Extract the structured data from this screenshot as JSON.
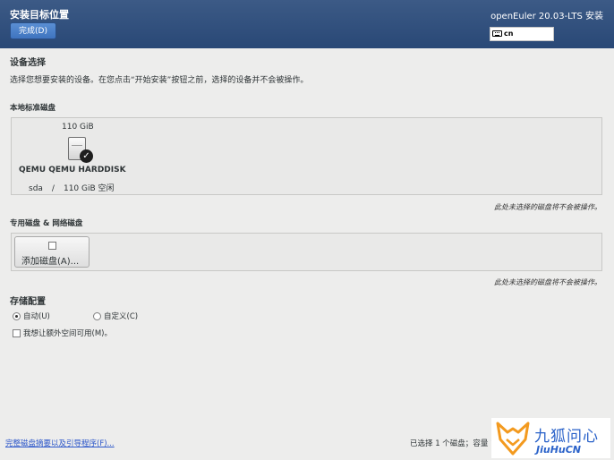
{
  "header": {
    "title": "安装目标位置",
    "done_button": "完成(D)",
    "product": "openEuler 20.03-LTS 安装",
    "keyboard_layout": "cn"
  },
  "device_selection": {
    "title": "设备选择",
    "description": "选择您想要安装的设备。在您点击“开始安装”按钮之前，选择的设备并不会被操作。"
  },
  "local_disks": {
    "title": "本地标准磁盘",
    "disk": {
      "size": "110 GiB",
      "name": "QEMU QEMU HARDDISK",
      "device": "sda",
      "separator": "/",
      "free": "110 GiB 空闲"
    },
    "note": "此处未选择的磁盘将不会被操作。"
  },
  "special_disks": {
    "title": "专用磁盘 & 网络磁盘",
    "add_button": "添加磁盘(A)...",
    "note": "此处未选择的磁盘将不会被操作。"
  },
  "storage_config": {
    "title": "存储配置",
    "options": [
      {
        "label": "自动(U)",
        "selected": true
      },
      {
        "label": "自定义(C)",
        "selected": false
      }
    ],
    "extra_space_label": "我想让额外空间可用(M)。",
    "extra_space_checked": false
  },
  "footer": {
    "summary_link": "完整磁盘摘要以及引导程序(F)...",
    "status": "已选择 1 个磁盘；容量 1"
  },
  "watermark": {
    "cn": "九狐问心",
    "en": "JiuHuCN"
  },
  "colors": {
    "header_bg": "#294876",
    "accent": "#3f74bf",
    "link": "#2a55c9",
    "watermark": "#2a62c9",
    "fox_orange": "#f39a1f"
  }
}
